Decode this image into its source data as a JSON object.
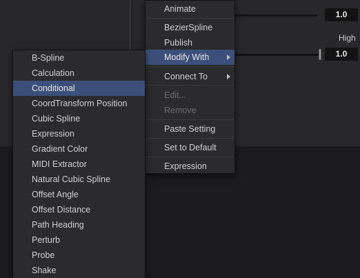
{
  "background": {
    "value_top": "1.0",
    "value_high": "1.0",
    "high_label": "High"
  },
  "context_menu": {
    "items": [
      {
        "label": "Animate",
        "disabled": false
      },
      {
        "label": "BezierSpline",
        "disabled": false
      },
      {
        "label": "Publish",
        "disabled": false
      },
      {
        "label": "Modify With",
        "disabled": false,
        "submenu": true,
        "highlighted": true
      },
      {
        "label": "Connect To",
        "disabled": false,
        "submenu": true
      },
      {
        "label": "Edit...",
        "disabled": true
      },
      {
        "label": "Remove",
        "disabled": true
      },
      {
        "label": "Paste Setting",
        "disabled": false
      },
      {
        "label": "Set to Default",
        "disabled": false
      },
      {
        "label": "Expression",
        "disabled": false
      }
    ]
  },
  "modify_with_submenu": {
    "items": [
      "B-Spline",
      "Calculation",
      "Conditional",
      "CoordTransform Position",
      "Cubic Spline",
      "Expression",
      "Gradient Color",
      "MIDI Extractor",
      "Natural Cubic Spline",
      "Offset Angle",
      "Offset Distance",
      "Path Heading",
      "Perturb",
      "Probe",
      "Shake"
    ],
    "highlighted": "Conditional"
  },
  "colors": {
    "highlight": "#3b4f7a",
    "menu_bg": "#2b2b2d",
    "disabled_text": "#6e6e70"
  }
}
